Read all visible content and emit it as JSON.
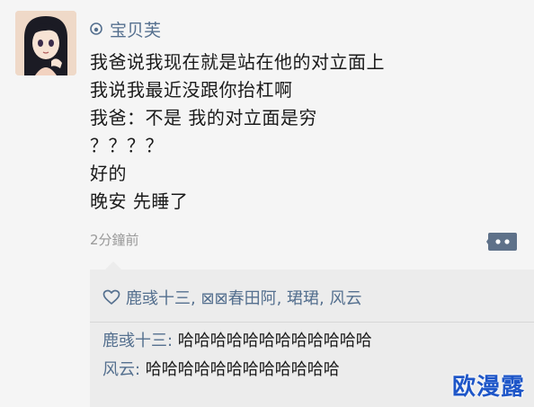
{
  "post": {
    "author": "宝贝芙",
    "lines": [
      "我爸说我现在就是站在他的对立面上",
      "我说我最近没跟你抬杠啊",
      "我爸：不是 我的对立面是穷",
      "？？？？",
      "好的",
      "晚安 先睡了"
    ],
    "time": "2分鐘前"
  },
  "likes": {
    "names": "鹿彧十三, ⊠⊠春田阿, 珺珺, 风云"
  },
  "comments": [
    {
      "author": "鹿彧十三:",
      "text": " 哈哈哈哈哈哈哈哈哈哈哈哈"
    },
    {
      "author": "风云:",
      "text": " 哈哈哈哈哈哈哈哈哈哈哈哈"
    }
  ],
  "watermark": "欧漫露",
  "colors": {
    "link": "#55708f",
    "panel": "#ececec",
    "background": "#f5f5f5",
    "watermark": "#1e56c8"
  },
  "icons": [
    "avatar",
    "weibo-icon",
    "comment-icon",
    "heart-icon"
  ]
}
